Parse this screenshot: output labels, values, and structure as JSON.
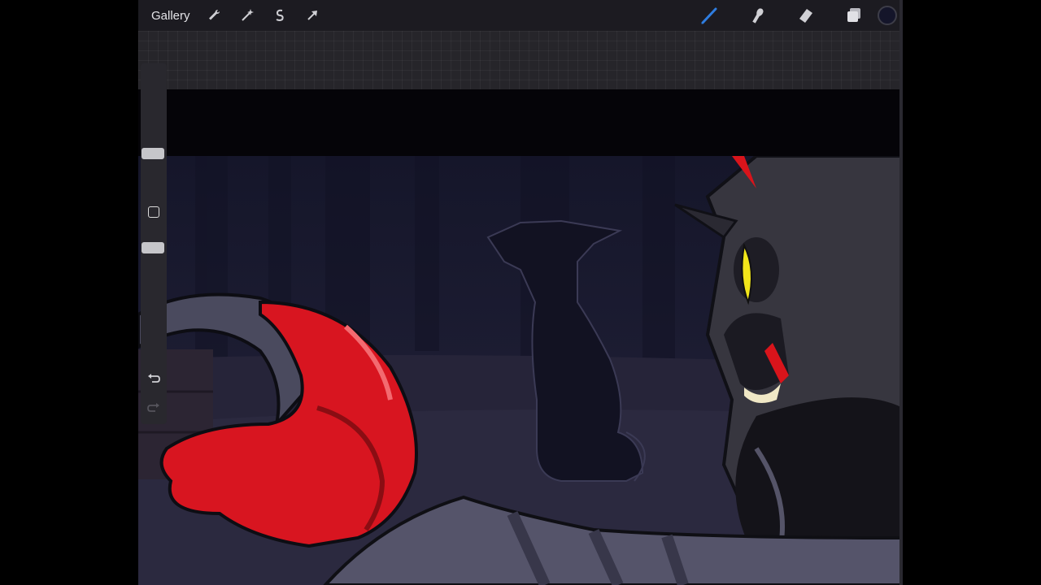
{
  "toolbar": {
    "gallery_label": "Gallery",
    "left_tools": [
      "wrench-icon",
      "magic-wand-icon",
      "selection-icon",
      "transform-arrow-icon"
    ],
    "right_tools": [
      "brush-icon",
      "smudge-icon",
      "eraser-icon",
      "layers-icon"
    ],
    "active_tool": "brush",
    "active_tool_color": "#2f7de0",
    "current_color": "#14152a"
  },
  "sidebar": {
    "brush_size": 0.28,
    "opacity": 0.55,
    "undo_icon": "undo-icon",
    "redo_icon": "redo-icon"
  }
}
